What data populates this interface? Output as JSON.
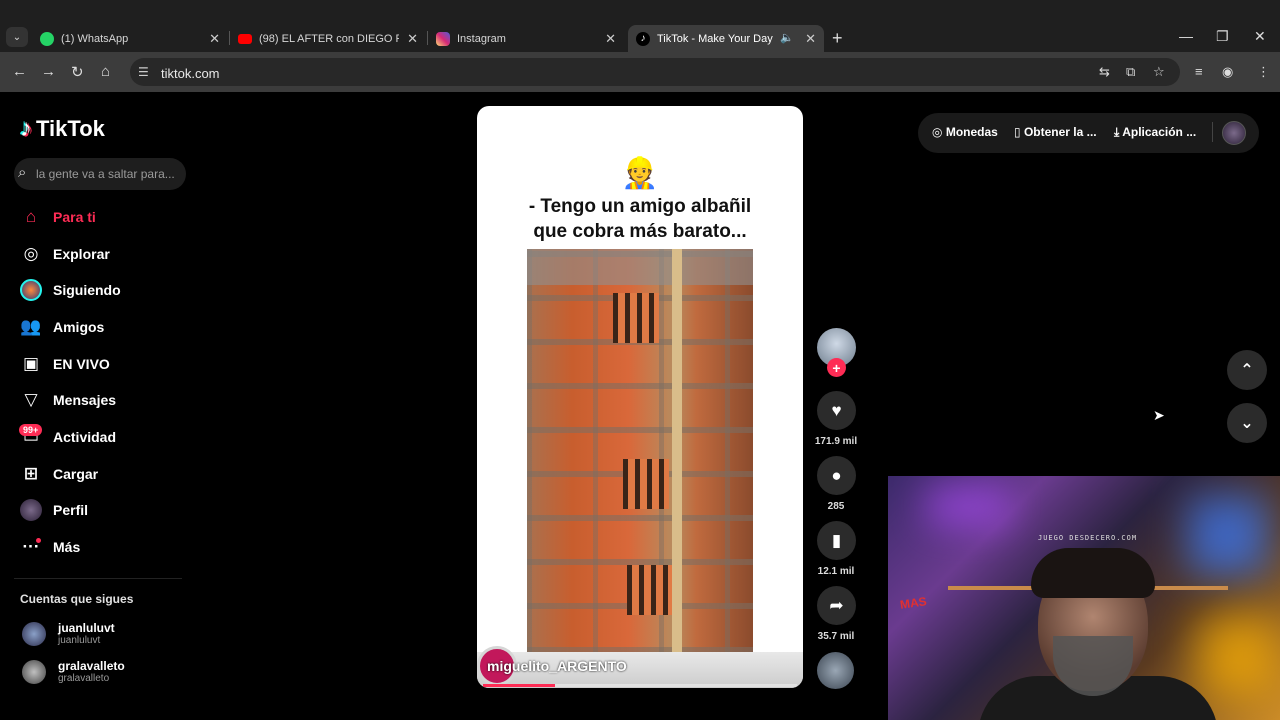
{
  "browser": {
    "tabs": [
      {
        "title": "(1) WhatsApp",
        "favicon_color": "#25d366"
      },
      {
        "title": "(98) EL AFTER con DIEGO POGG",
        "favicon_color": "#ff0000"
      },
      {
        "title": "Instagram",
        "favicon_color": "#d6249f"
      },
      {
        "title": "TikTok - Make Your Day",
        "favicon_color": "#000000"
      }
    ],
    "url": "tiktok.com"
  },
  "tiktok": {
    "logo_text": "TikTok",
    "search_placeholder": "la gente va a saltar para...",
    "nav": [
      {
        "label": "Para ti"
      },
      {
        "label": "Explorar"
      },
      {
        "label": "Siguiendo"
      },
      {
        "label": "Amigos"
      },
      {
        "label": "EN VIVO"
      },
      {
        "label": "Mensajes"
      },
      {
        "label": "Actividad"
      },
      {
        "label": "Cargar"
      },
      {
        "label": "Perfil"
      },
      {
        "label": "Más"
      }
    ],
    "activity_badge": "99+",
    "following_title": "Cuentas que sigues",
    "following": [
      {
        "name": "juanluluvt",
        "handle": "juanluluvt"
      },
      {
        "name": "gralavalleto",
        "handle": "gralavalleto"
      }
    ],
    "video": {
      "emoji": "👷",
      "caption_line1": "- Tengo un amigo albañil",
      "caption_line2": "que cobra más barato...",
      "handle": "miguelito_ARGENTO",
      "progress": 0.23
    },
    "actions": {
      "likes": "171.9 mil",
      "comments": "285",
      "saves": "12.1 mil",
      "shares": "35.7 mil"
    },
    "topbar": {
      "coins": "Monedas",
      "get_app": "Obtener la ...",
      "desktop_app": "Aplicación ..."
    }
  },
  "webcam": {
    "overlay_text": "JUEGO DESDECERO.COM",
    "sign_text": "MAS"
  },
  "colors": {
    "accent": "#fe2c55",
    "cyan": "#25f4ee"
  }
}
